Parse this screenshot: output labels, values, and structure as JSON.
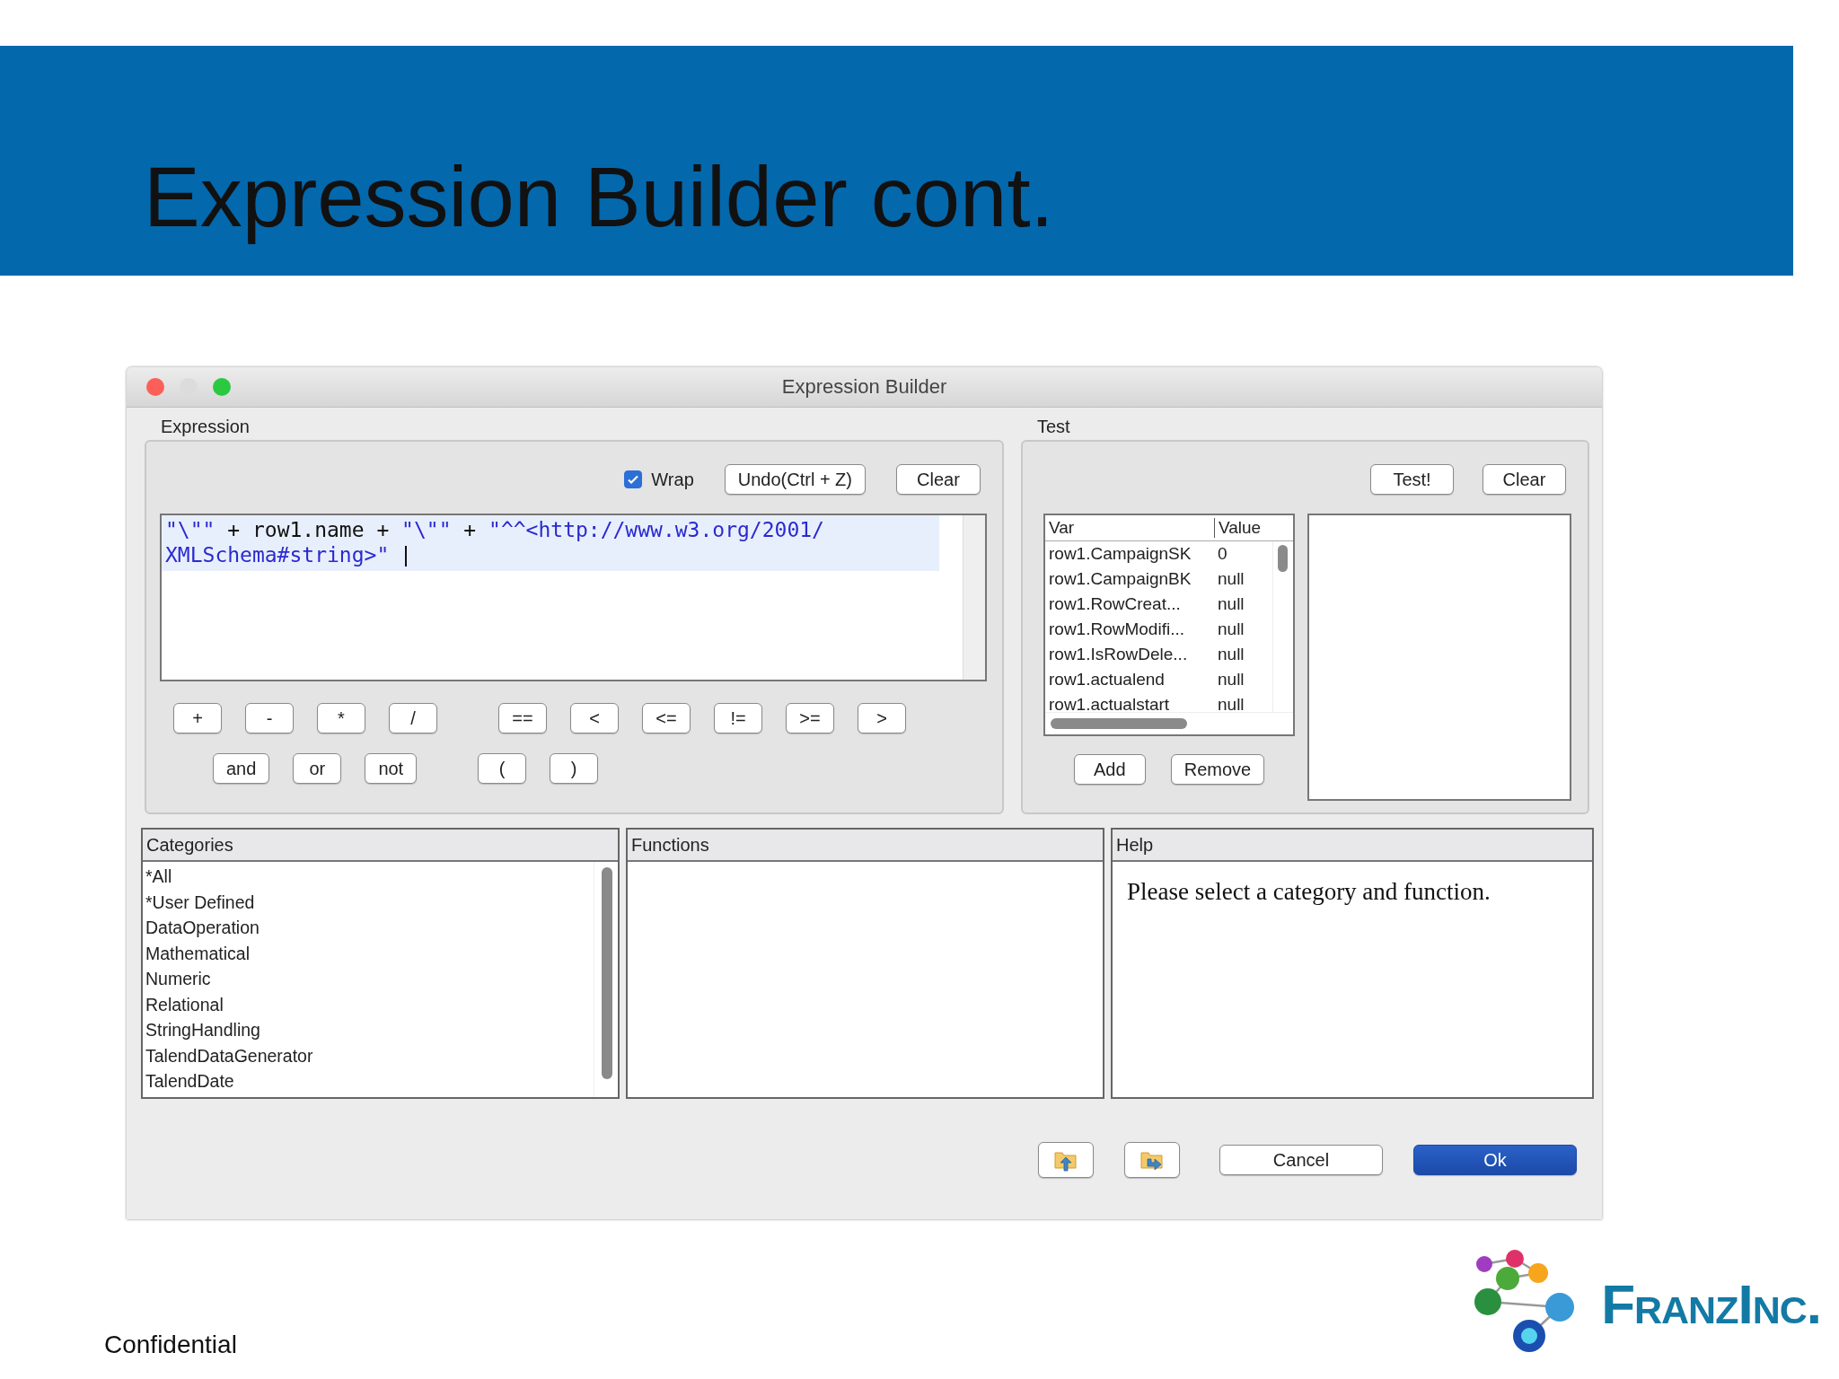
{
  "slide": {
    "title": "Expression Builder cont.",
    "footer": "Confidential",
    "logo_text": "FranzInc."
  },
  "window": {
    "title": "Expression Builder"
  },
  "expression": {
    "label": "Expression",
    "wrap": {
      "label": "Wrap",
      "checked": true
    },
    "buttons": [
      "Undo(Ctrl + Z)",
      "Clear"
    ],
    "lines": [
      [
        {
          "text": "\"\\\"\"",
          "kind": "string"
        },
        {
          "text": " + row1.name + ",
          "kind": "code"
        },
        {
          "text": "\"\\\"\"",
          "kind": "string"
        },
        {
          "text": " + ",
          "kind": "code"
        },
        {
          "text": "\"^^<http://www.w3.org/2001/",
          "kind": "string"
        }
      ],
      [
        {
          "text": "XMLSchema#string>\" ",
          "kind": "string"
        }
      ]
    ],
    "operator_rows": [
      [
        [
          "+",
          "-",
          "*",
          "/"
        ],
        [
          "==",
          "<",
          "<=",
          "!=",
          ">=",
          ">"
        ]
      ],
      [
        [
          "and",
          "or",
          "not"
        ],
        [
          "(",
          ")"
        ]
      ]
    ]
  },
  "test": {
    "label": "Test",
    "buttons": [
      "Test!",
      "Clear"
    ],
    "columns": [
      "Var",
      "Value"
    ],
    "rows": [
      [
        "row1.CampaignSK",
        "0"
      ],
      [
        "row1.CampaignBK",
        "null"
      ],
      [
        "row1.RowCreat...",
        "null"
      ],
      [
        "row1.RowModifi...",
        "null"
      ],
      [
        "row1.IsRowDele...",
        "null"
      ],
      [
        "row1.actualend",
        "null"
      ],
      [
        "row1.actualstart",
        "null"
      ]
    ],
    "list_buttons": [
      "Add",
      "Remove"
    ]
  },
  "categories": {
    "title": "Categories",
    "items": [
      "*All",
      "*User Defined",
      "DataOperation",
      "Mathematical",
      "Numeric",
      "Relational",
      "StringHandling",
      "TalendDataGenerator",
      "TalendDate"
    ]
  },
  "functions": {
    "title": "Functions"
  },
  "help": {
    "title": "Help",
    "text": "Please select a category and function."
  },
  "buttons": [
    {
      "kind": "import"
    },
    {
      "kind": "export"
    },
    {
      "kind": "default",
      "label": "Cancel"
    },
    {
      "kind": "primary",
      "label": "Ok"
    }
  ]
}
